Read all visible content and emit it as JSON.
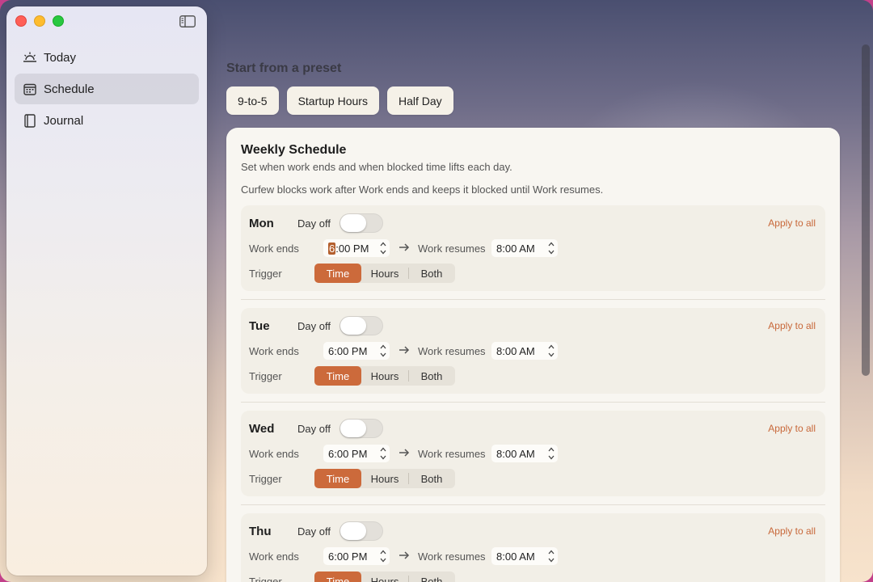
{
  "sidebar": {
    "items": [
      {
        "label": "Today",
        "icon": "sunrise-icon"
      },
      {
        "label": "Schedule",
        "icon": "calendar-icon"
      },
      {
        "label": "Journal",
        "icon": "book-icon"
      }
    ],
    "active_index": 1
  },
  "presets": {
    "title": "Start from a preset",
    "buttons": [
      "9-to-5",
      "Startup Hours",
      "Half Day"
    ]
  },
  "schedule": {
    "title": "Weekly Schedule",
    "subtitle": "Set when work ends and when blocked time lifts each day.",
    "note": "Curfew blocks work after Work ends and keeps it blocked until Work resumes.",
    "labels": {
      "day_off": "Day off",
      "apply_all": "Apply to all",
      "work_ends": "Work ends",
      "work_resumes": "Work resumes",
      "trigger": "Trigger"
    },
    "trigger_options": [
      "Time",
      "Hours",
      "Both"
    ],
    "days": [
      {
        "name": "Mon",
        "day_off": false,
        "work_ends_sel": "6",
        "work_ends_rest": ":00 PM",
        "work_resumes": "8:00 AM",
        "trigger": "Time"
      },
      {
        "name": "Tue",
        "day_off": false,
        "work_ends": "6:00 PM",
        "work_resumes": "8:00 AM",
        "trigger": "Time"
      },
      {
        "name": "Wed",
        "day_off": false,
        "work_ends": "6:00 PM",
        "work_resumes": "8:00 AM",
        "trigger": "Time"
      },
      {
        "name": "Thu",
        "day_off": false,
        "work_ends": "6:00 PM",
        "work_resumes": "8:00 AM",
        "trigger": "Time"
      }
    ]
  },
  "colors": {
    "accent": "#cc6a3b",
    "link": "#c8683a"
  }
}
